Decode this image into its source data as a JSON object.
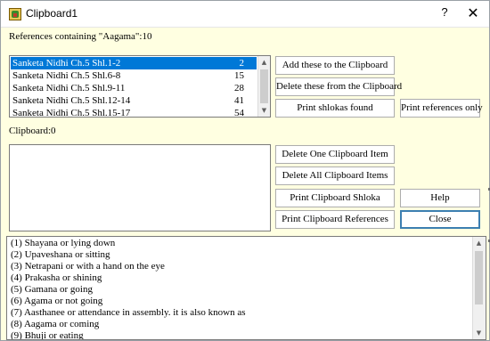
{
  "window": {
    "title": "Clipboard1",
    "help_glyph": "?",
    "close_glyph": "✕"
  },
  "references": {
    "label": "References containing \"Aagama\":10",
    "rows": [
      {
        "text": "Sanketa Nidhi Ch.5 Shl.1-2",
        "value": "2",
        "selected": true
      },
      {
        "text": "Sanketa Nidhi Ch.5 Shl.6-8",
        "value": "15",
        "selected": false
      },
      {
        "text": "Sanketa Nidhi Ch.5 Shl.9-11",
        "value": "28",
        "selected": false
      },
      {
        "text": "Sanketa Nidhi Ch.5 Shl.12-14",
        "value": "41",
        "selected": false
      },
      {
        "text": "Sanketa Nidhi Ch.5 Shl.15-17",
        "value": "54",
        "selected": false
      }
    ],
    "buttons": {
      "add": "Add these to the Clipboard",
      "delete": "Delete these from the Clipboard",
      "print_shlokas": "Print shlokas found",
      "print_refs": "Print references only"
    }
  },
  "clipboard": {
    "label": "Clipboard:0",
    "buttons": {
      "delete_one": "Delete One Clipboard Item",
      "delete_all": "Delete All Clipboard Items",
      "print_shloka": "Print Clipboard Shloka",
      "help": "Help",
      "print_refs": "Print Clipboard References",
      "close": "Close"
    }
  },
  "descriptions": [
    "(1) Shayana or lying down",
    " (2) Upaveshana or sitting",
    " (3) Netrapani or with a hand on the eye",
    " (4) Prakasha or shining",
    " (5) Gamana or going",
    " (6) Agama or not going",
    " (7) Aasthanee or attendance in assembly. it is also known as",
    " (8) Aagama or coming",
    " (9) Bhuji or eating"
  ],
  "scroll_glyphs": {
    "up": "▲",
    "down": "▼"
  }
}
